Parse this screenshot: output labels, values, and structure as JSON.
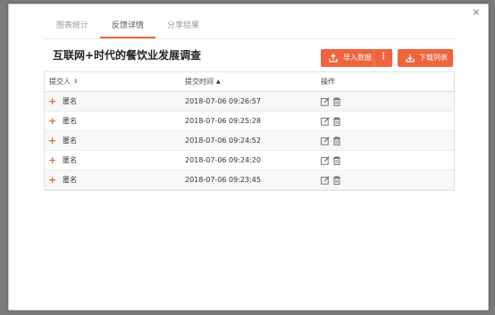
{
  "modal": {
    "close_label": "×",
    "tabs": [
      {
        "label": "图表统计",
        "active": false
      },
      {
        "label": "反馈详情",
        "active": true
      },
      {
        "label": "分享结果",
        "active": false
      }
    ],
    "title": "互联网+时代的餐饮业发展调查",
    "import_button": {
      "label": "导入数据",
      "more": "⋮"
    },
    "download_button": {
      "label": "下载列表"
    }
  },
  "table": {
    "columns": [
      {
        "label": "提交人",
        "sort": "⇕"
      },
      {
        "label": "提交时间",
        "sort": "▲"
      },
      {
        "label": "操作"
      }
    ],
    "rows": [
      {
        "expand": "+",
        "submitter": "匿名",
        "time": "2018-07-06 09:26:57"
      },
      {
        "expand": "+",
        "submitter": "匿名",
        "time": "2018-07-06 09:25:28"
      },
      {
        "expand": "+",
        "submitter": "匿名",
        "time": "2018-07-06 09:24:52"
      },
      {
        "expand": "+",
        "submitter": "匿名",
        "time": "2018-07-06 09:24:20"
      },
      {
        "expand": "+",
        "submitter": "匿名",
        "time": "2018-07-06 09:23:45"
      }
    ]
  },
  "colors": {
    "accent": "#f0643c",
    "overlay": "#7a7a7a"
  }
}
